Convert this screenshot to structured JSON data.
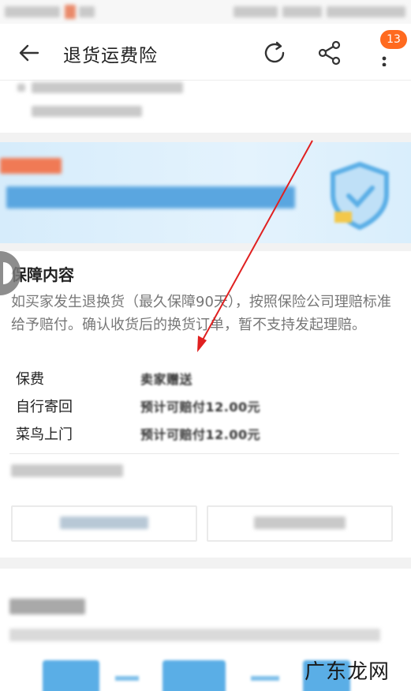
{
  "header": {
    "title": "退货运费险",
    "badge_count": "13",
    "icons": [
      "back-arrow-icon",
      "refresh-icon",
      "share-icon",
      "more-icon"
    ]
  },
  "coverage": {
    "title": "保障内容",
    "description": "如买家发生退换货（最久保障90天），按照保险公司理赔标准给予赔付。确认收货后的换货订单，暂不支持发起理赔。",
    "rows": [
      {
        "label": "保费",
        "value": "卖家赠送"
      },
      {
        "label": "自行寄回",
        "value": "预计可赔付12.00元"
      },
      {
        "label": "菜鸟上门",
        "value": "预计可赔付12.00元"
      }
    ]
  },
  "watermark": "广东龙网",
  "colors": {
    "badge": "#ff6a1f",
    "annotation_arrow": "#e02020",
    "banner_bg": "#d6ecfb"
  }
}
